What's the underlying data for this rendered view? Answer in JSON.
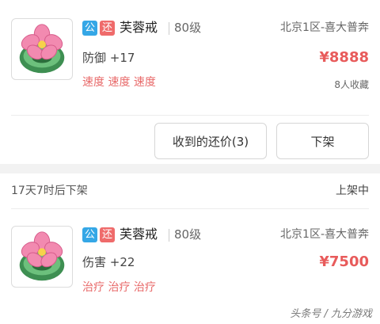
{
  "listings": [
    {
      "item_icon": "lotus-jade-ring-icon",
      "badge_public": "公",
      "badge_return": "还",
      "name": "芙蓉戒",
      "level": "80级",
      "server": "北京1区-喜大普奔",
      "stat": "防御 +17",
      "price": "¥8888",
      "tags": "速度 速度 速度",
      "favorites": "8人收藏",
      "buttons": {
        "offers": "收到的还价(3)",
        "delist": "下架"
      }
    },
    {
      "item_icon": "lotus-jade-ring-icon",
      "time_left": "17天7时后下架",
      "status": "上架中",
      "badge_public": "公",
      "badge_return": "还",
      "name": "芙蓉戒",
      "level": "80级",
      "server": "北京1区-喜大普奔",
      "stat": "伤害 +22",
      "price": "¥7500",
      "tags": "治疗 治疗 治疗"
    }
  ],
  "watermark": "头条号 / 九分游戏",
  "colors": {
    "price": "#e85b5b",
    "badge_public": "#35a7e6",
    "badge_return": "#ef6b6b",
    "background": "#f2f2f2"
  }
}
